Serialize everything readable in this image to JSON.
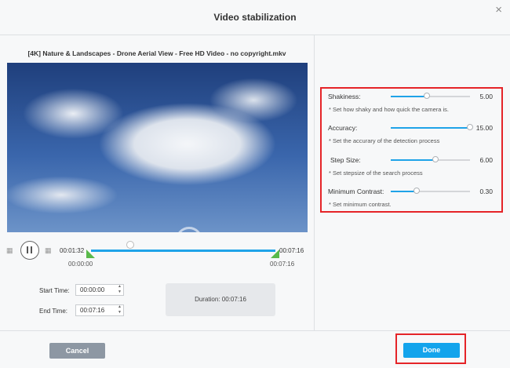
{
  "dialog": {
    "title": "Video stabilization",
    "close": "×"
  },
  "file": {
    "name": "[4K] Nature & Landscapes - Drone Aerial View - Free HD Video - no copyright.mkv"
  },
  "preview": {
    "watermark": "uantrimang"
  },
  "player": {
    "current_time": "00:01:32",
    "total_time": "00:07:16",
    "clip_start": "00:00:00",
    "clip_end": "00:07:16",
    "playhead_fraction": 0.21
  },
  "trim": {
    "start_label": "Start Time:",
    "start_value": "00:00:00",
    "end_label": "End Time:",
    "end_value": "00:07:16",
    "duration_label": "Duration:",
    "duration_value": "00:07:16"
  },
  "settings": [
    {
      "label": "Shakiness:",
      "value": "5.00",
      "level": 0.46,
      "hint": "* Set how shaky and how quick the camera is."
    },
    {
      "label": "Accuracy:",
      "value": "15.00",
      "level": 1.0,
      "hint": "* Set the accurary of the detection process"
    },
    {
      "label": "Step Size:",
      "value": "6.00",
      "level": 0.56,
      "hint": "* Set stepsize of the search process"
    },
    {
      "label": "Minimum Contrast:",
      "value": "0.30",
      "level": 0.33,
      "hint": "* Set minimum contrast."
    }
  ],
  "footer": {
    "cancel_label": "Cancel",
    "done_label": "Done"
  },
  "colors": {
    "accent": "#13a4ec",
    "highlight": "#e52428",
    "handle": "#59b94a"
  }
}
